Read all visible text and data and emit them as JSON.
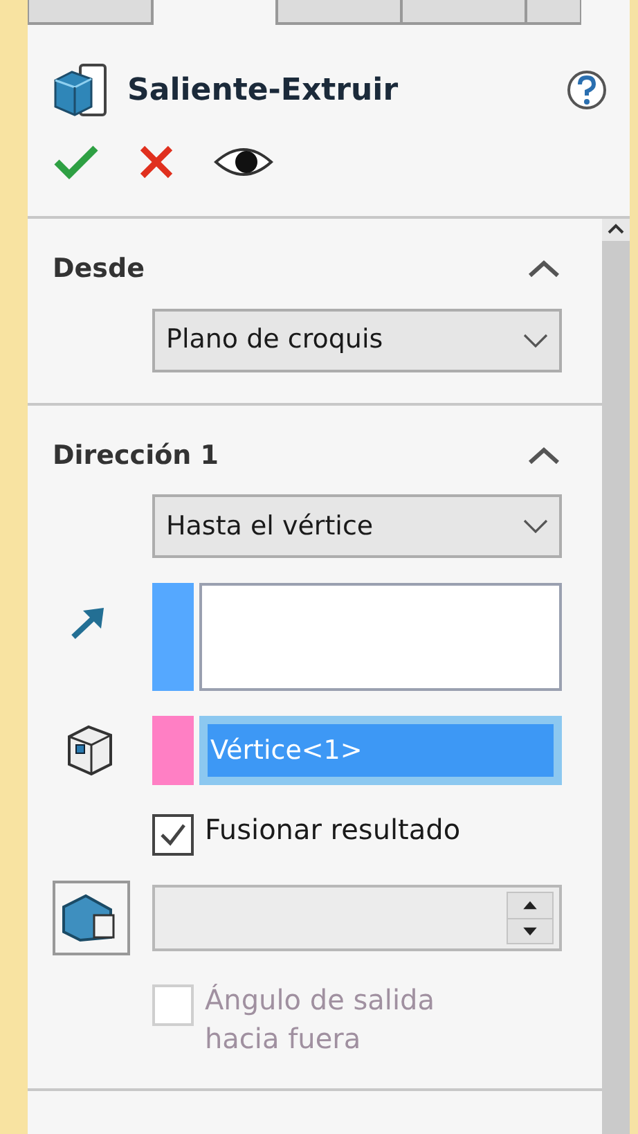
{
  "tabs": [
    {
      "selected": false
    },
    {
      "selected": true
    },
    {
      "selected": false
    },
    {
      "selected": false
    },
    {
      "selected": false
    }
  ],
  "title": "Saliente-Extruir",
  "sections": [
    {
      "kind": "from",
      "title": "Desde",
      "expanded": true,
      "dropdown": "Plano de croquis"
    },
    {
      "kind": "direction",
      "title": "Dirección 1",
      "expanded": true,
      "dropdown": "Hasta el vértice",
      "direction_field": {
        "color": "#55a8ff"
      },
      "vertex_field": {
        "color": "#ff7fc4",
        "value": "Vértice<1>",
        "selected": true
      },
      "merge": {
        "label": "Fusionar resultado",
        "checked": true,
        "disabled": false
      },
      "draft_field": {
        "disabled": true
      },
      "draft_outward": {
        "label": "Ángulo de salida hacia fuera",
        "checked": false,
        "disabled": true
      }
    }
  ]
}
